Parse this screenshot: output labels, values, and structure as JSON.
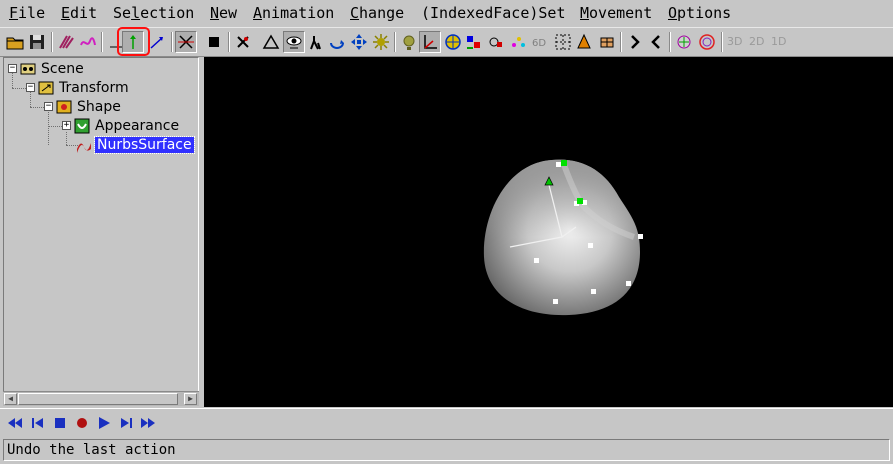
{
  "menu": [
    {
      "ul": "F",
      "rest": "ile"
    },
    {
      "ul": "E",
      "rest": "dit"
    },
    {
      "pre": "Se",
      "ul": "l",
      "rest": "ection"
    },
    {
      "ul": "N",
      "rest": "ew"
    },
    {
      "ul": "A",
      "rest": "nimation"
    },
    {
      "ul": "C",
      "rest": "hange"
    },
    {
      "pre": "(IndexedFace)Set"
    },
    {
      "ul": "M",
      "rest": "ovement"
    },
    {
      "ul": "O",
      "rest": "ptions"
    }
  ],
  "toolbar": {
    "dim_3d": "3D",
    "dim_2d": "2D",
    "dim_1d": "1D",
    "next_symbol": ">",
    "prev_symbol": "<"
  },
  "tree": {
    "scene": "Scene",
    "transform": "Transform",
    "shape": "Shape",
    "appearance": "Appearance",
    "nurbs": "NurbsSurface"
  },
  "status": "Undo the last action",
  "colors": {
    "selection": "#3030ff",
    "highlight_box": "#ff1010",
    "control_point": "#ffffff",
    "active_point": "#00e000"
  },
  "icons": {
    "highlighted_tool": "move-y-axis-icon"
  }
}
